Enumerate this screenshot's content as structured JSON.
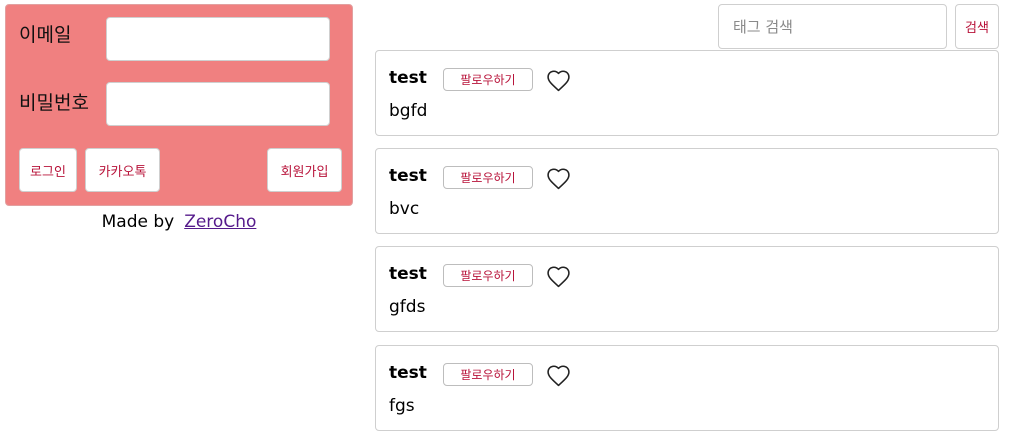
{
  "login": {
    "email_label": "이메일",
    "email_value": "",
    "password_label": "비밀번호",
    "password_value": "",
    "login_button": "로그인",
    "kakao_button": "카카오톡",
    "join_button": "회원가입"
  },
  "footer": {
    "made_by": "Made by",
    "author_link": "ZeroCho"
  },
  "search": {
    "placeholder": "태그 검색",
    "button": "검색"
  },
  "posts": [
    {
      "author": "test",
      "follow_label": "팔로우하기",
      "content": "bgfd"
    },
    {
      "author": "test",
      "follow_label": "팔로우하기",
      "content": "bvc"
    },
    {
      "author": "test",
      "follow_label": "팔로우하기",
      "content": "gfds"
    },
    {
      "author": "test",
      "follow_label": "팔로우하기",
      "content": "fgs"
    }
  ],
  "colors": {
    "panel_bg": "#f08080",
    "accent_text": "#b8133a",
    "link": "#551a8b"
  },
  "icons": {
    "like": "heart-outline-icon"
  }
}
